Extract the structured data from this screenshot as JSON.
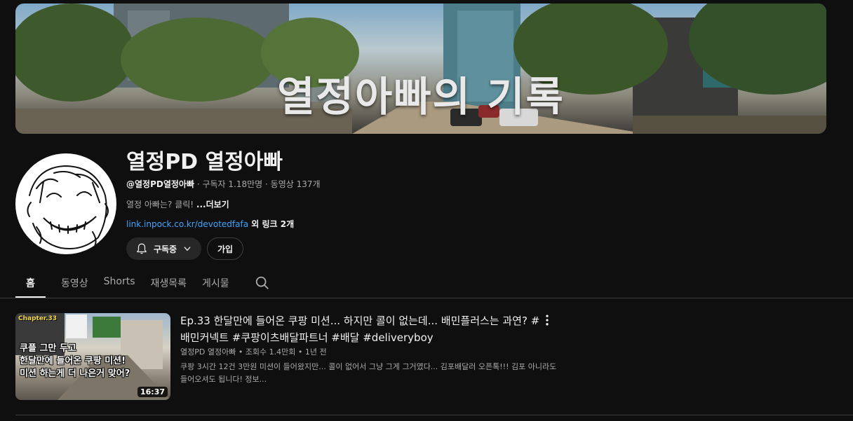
{
  "banner": {
    "title": "열정아빠의 기록"
  },
  "channel": {
    "name": "열정PD 열정아빠",
    "handle": "@열정PD열정아빠",
    "subscribers": "· 구독자 1.18만명",
    "videos": "· 동영상 137개",
    "description": "열정 아빠는? 클릭! ",
    "more_label": "...더보기",
    "link_url": "link.inpock.co.kr/devotedfafa",
    "link_extra": " 외 링크 2개"
  },
  "buttons": {
    "subscribed_label": "구독중",
    "join_label": "가입"
  },
  "tabs": [
    {
      "label": "홈"
    },
    {
      "label": "동영상"
    },
    {
      "label": "Shorts"
    },
    {
      "label": "재생목록"
    },
    {
      "label": "게시물"
    }
  ],
  "video": {
    "title": "Ep.33 한달만에 들어온 쿠팡 미션... 하지만 콜이 없는데... 배민플러스는 과연? #배민커넥트 #쿠팡이츠배달파트너 #배달 #deliveryboy",
    "meta": "열정PD 열정아빠 • 조회수 1.4만회 • 1년 전",
    "description": "쿠팡 3시간 12건 3만원 미션이 들어왔지만... 콜이 없어서 그냥 그게 그거였다... 김포배달러 오픈톡!!! 김포 아니라도 들어오셔도 됩니다! 정보...",
    "duration": "16:37",
    "thumb_chip": "Chapter.33",
    "thumb_line1": "쿠플 그만 두고",
    "thumb_line2": "한달만에 들어온 쿠팡 미션!",
    "thumb_line3": "미션 하는게 더 나은거 맞어?"
  },
  "icons": {
    "bell": "bell-icon",
    "chevron": "chevron-down-icon",
    "search": "search-icon",
    "more": "more-vert-icon"
  }
}
